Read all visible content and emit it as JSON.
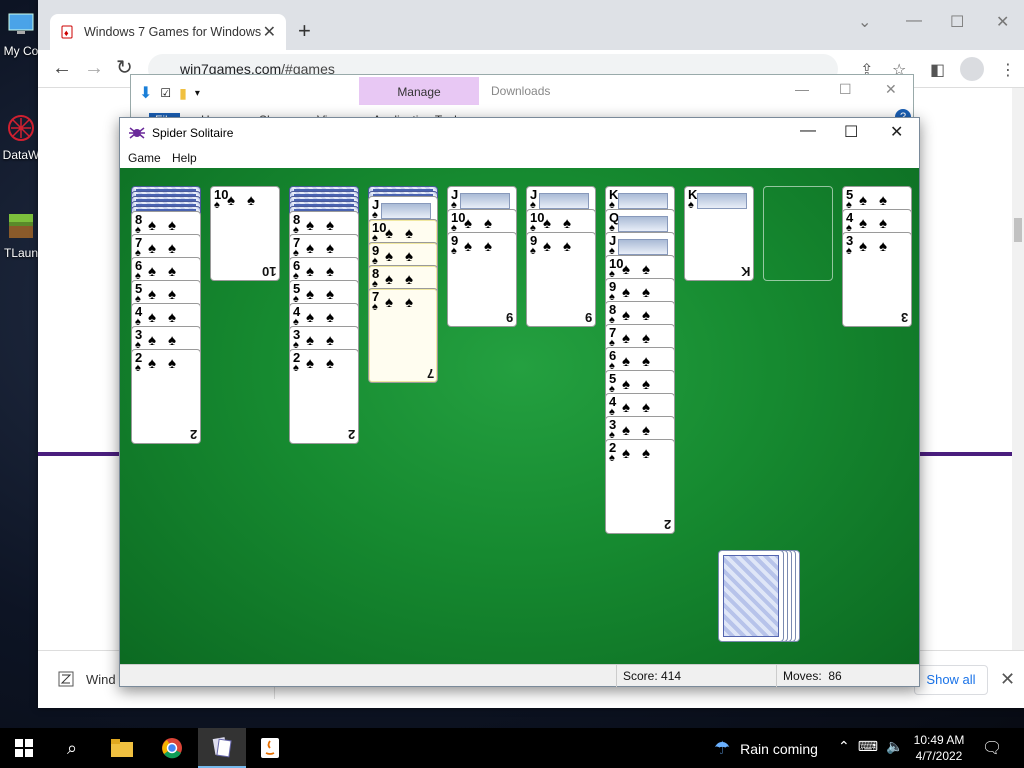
{
  "desktop": {
    "icons": [
      {
        "label": "My Co",
        "icon": "computer-icon"
      },
      {
        "label": "DataW",
        "icon": "datawatch-icon"
      },
      {
        "label": "TLaun",
        "icon": "minecraft-launcher-icon"
      }
    ]
  },
  "browser": {
    "tab_title": "Windows 7 Games for Windows",
    "tab_close": "✕",
    "new_tab": "+",
    "url_host": "win7games.com",
    "url_path": "/#games",
    "downloads_bar": {
      "item_label": "Wind",
      "show_all": "Show all",
      "close": "✕"
    }
  },
  "explorer": {
    "manage_tab": "Manage",
    "title": "Downloads",
    "ribbon_tabs": [
      "File",
      "Home",
      "Share",
      "View",
      "Application Tools"
    ],
    "help": "?"
  },
  "spider": {
    "title": "Spider Solitaire",
    "menu": [
      "Game",
      "Help"
    ],
    "status": {
      "score_label": "Score:",
      "score": "414",
      "moves_label": "Moves:",
      "moves": "86"
    },
    "columns": [
      {
        "hidden": 5,
        "cards": [
          "8",
          "7",
          "6",
          "5",
          "4",
          "3",
          "2"
        ]
      },
      {
        "hidden": 0,
        "cards": [
          "10"
        ]
      },
      {
        "hidden": 5,
        "cards": [
          "8",
          "7",
          "6",
          "5",
          "4",
          "3",
          "2"
        ]
      },
      {
        "hidden": 2,
        "cards": [
          "J",
          "10",
          "9",
          "8",
          "7"
        ]
      },
      {
        "hidden": 0,
        "cards": [
          "J",
          "10",
          "9"
        ]
      },
      {
        "hidden": 0,
        "cards": [
          "J",
          "10",
          "9"
        ]
      },
      {
        "hidden": 0,
        "cards": [
          "K",
          "Q",
          "J",
          "10",
          "9",
          "8",
          "7",
          "6",
          "5",
          "4",
          "3",
          "2"
        ]
      },
      {
        "hidden": 0,
        "cards": [
          "K"
        ]
      },
      {
        "hidden": 0,
        "cards": []
      },
      {
        "hidden": 0,
        "cards": [
          "5",
          "4",
          "3"
        ]
      }
    ],
    "suit": "♠",
    "stock_piles": 5
  },
  "taskbar": {
    "weather": "Rain coming",
    "time": "10:49 AM",
    "date": "4/7/2022"
  },
  "colors": {
    "felt": "#168a30",
    "accent_purple": "#4a1e7e",
    "taskbar": "#000000"
  }
}
